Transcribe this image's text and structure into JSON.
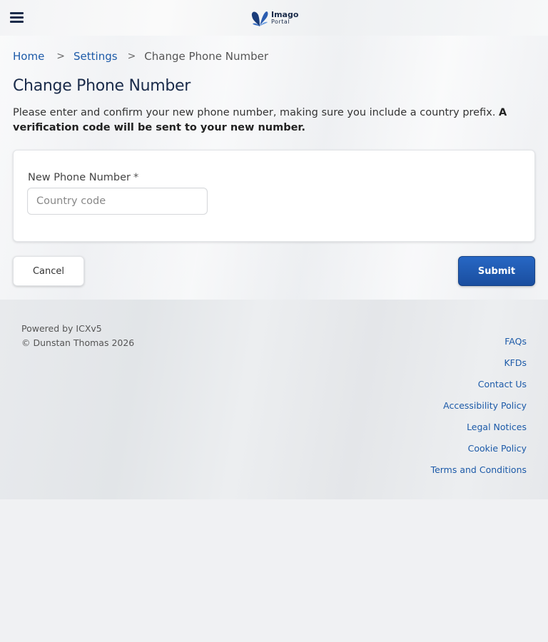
{
  "header": {
    "menu_icon": "hamburger-menu-icon",
    "logo": {
      "line1": "Imago",
      "line2": "Portal",
      "icon": "butterfly-logo-icon"
    }
  },
  "breadcrumb": {
    "home": "Home",
    "separator": ">",
    "settings": "Settings",
    "current": "Change Phone Number"
  },
  "page": {
    "title": "Change Phone Number",
    "intro_text": "Please enter and confirm your new phone number, making sure you include a country prefix.",
    "intro_bold": "A verification code will be sent to your new number."
  },
  "form": {
    "phone_label": "New Phone Number",
    "required_marker": "*",
    "phone_value": "",
    "phone_placeholder": "Country code"
  },
  "actions": {
    "cancel_label": "Cancel",
    "submit_label": "Submit"
  },
  "footer": {
    "powered_by": "Powered by ICXv5",
    "copyright": "© Dunstan Thomas 2026",
    "links": [
      "FAQs",
      "KFDs",
      "Contact Us",
      "Accessibility Policy",
      "Legal Notices",
      "Cookie Policy",
      "Terms and Conditions"
    ]
  },
  "colors": {
    "brand_navy": "#1a2b4a",
    "link_blue": "#1c5aa8",
    "submit_blue": "#1a4e9f"
  }
}
